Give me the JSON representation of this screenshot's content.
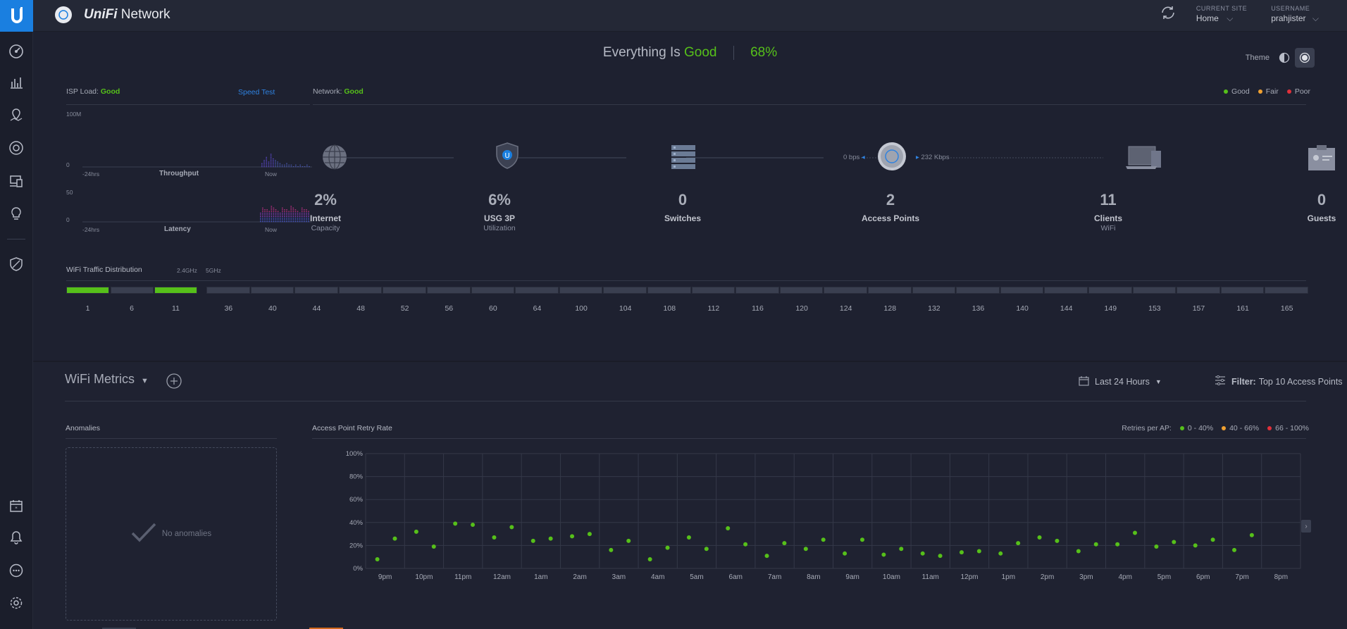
{
  "header": {
    "app_name_brand": "UniFi",
    "app_name_rest": "Network",
    "current_site_label": "CURRENT SITE",
    "current_site_value": "Home",
    "username_label": "USERNAME",
    "username_value": "prahjister"
  },
  "status": {
    "prefix": "Everything Is",
    "state": "Good",
    "score": "68%"
  },
  "theme": {
    "label": "Theme"
  },
  "isp": {
    "title_prefix": "ISP Load:",
    "state": "Good",
    "speed_test": "Speed Test",
    "throughput_max": "100M",
    "throughput_min": "0",
    "throughput_label": "Throughput",
    "latency_max": "50",
    "latency_min": "0",
    "latency_label": "Latency",
    "axis_start": "-24hrs",
    "axis_end": "Now"
  },
  "network": {
    "title_prefix": "Network:",
    "state": "Good",
    "legend": [
      {
        "label": "Good",
        "color": "#56c01a"
      },
      {
        "label": "Fair",
        "color": "#f0a030"
      },
      {
        "label": "Poor",
        "color": "#e0303a"
      }
    ],
    "rate_down": "0 bps",
    "rate_up": "232 Kbps",
    "nodes": [
      {
        "value": "2%",
        "label": "Internet",
        "sub": "Capacity"
      },
      {
        "value": "6%",
        "label": "USG 3P",
        "sub": "Utilization"
      },
      {
        "value": "0",
        "label": "Switches",
        "sub": ""
      },
      {
        "value": "2",
        "label": "Access Points",
        "sub": ""
      },
      {
        "value": "11",
        "label": "Clients",
        "sub": "WiFi"
      },
      {
        "value": "0",
        "label": "Guests",
        "sub": ""
      }
    ]
  },
  "wifi_traffic": {
    "title": "WiFi Traffic Distribution",
    "band_24": "2.4GHz",
    "band_5": "5GHz",
    "channels_24": [
      "1",
      "6",
      "11"
    ],
    "active_24": [
      true,
      false,
      true
    ],
    "channels_5": [
      "36",
      "40",
      "44",
      "48",
      "52",
      "56",
      "60",
      "64",
      "100",
      "104",
      "108",
      "112",
      "116",
      "120",
      "124",
      "128",
      "132",
      "136",
      "140",
      "144",
      "149",
      "153",
      "157",
      "161",
      "165"
    ]
  },
  "metrics": {
    "title": "WiFi Metrics",
    "range": "Last 24 Hours",
    "filter_label": "Filter:",
    "filter_value": "Top 10 Access Points",
    "anomalies_title": "Anomalies",
    "no_anomalies": "No anomalies",
    "retry_title": "Access Point Retry Rate",
    "retries_label": "Retries per AP:",
    "retry_legend": [
      {
        "label": "0 - 40%",
        "color": "#56c01a"
      },
      {
        "label": "40 - 66%",
        "color": "#f0a030"
      },
      {
        "label": "66 - 100%",
        "color": "#e0303a"
      }
    ]
  },
  "chart_data": {
    "type": "scatter",
    "title": "Access Point Retry Rate",
    "ylim": [
      0,
      100
    ],
    "y_ticks": [
      "0%",
      "20%",
      "40%",
      "60%",
      "80%",
      "100%"
    ],
    "categories": [
      "9pm",
      "10pm",
      "11pm",
      "12am",
      "1am",
      "2am",
      "3am",
      "4am",
      "5am",
      "6am",
      "7am",
      "8am",
      "9am",
      "10am",
      "11am",
      "12pm",
      "1pm",
      "2pm",
      "3pm",
      "4pm",
      "5pm",
      "6pm",
      "7pm",
      "8pm"
    ],
    "series": [
      {
        "values": [
          8,
          32,
          39,
          27,
          24,
          28,
          16,
          8,
          27,
          35,
          11,
          17,
          13,
          12,
          13,
          14,
          13,
          27,
          15,
          21,
          19,
          20,
          16,
          null
        ]
      },
      {
        "values": [
          26,
          19,
          38,
          36,
          26,
          30,
          24,
          18,
          17,
          21,
          22,
          25,
          25,
          17,
          11,
          15,
          22,
          24,
          21,
          31,
          23,
          25,
          29,
          null
        ]
      }
    ],
    "grid": true
  }
}
